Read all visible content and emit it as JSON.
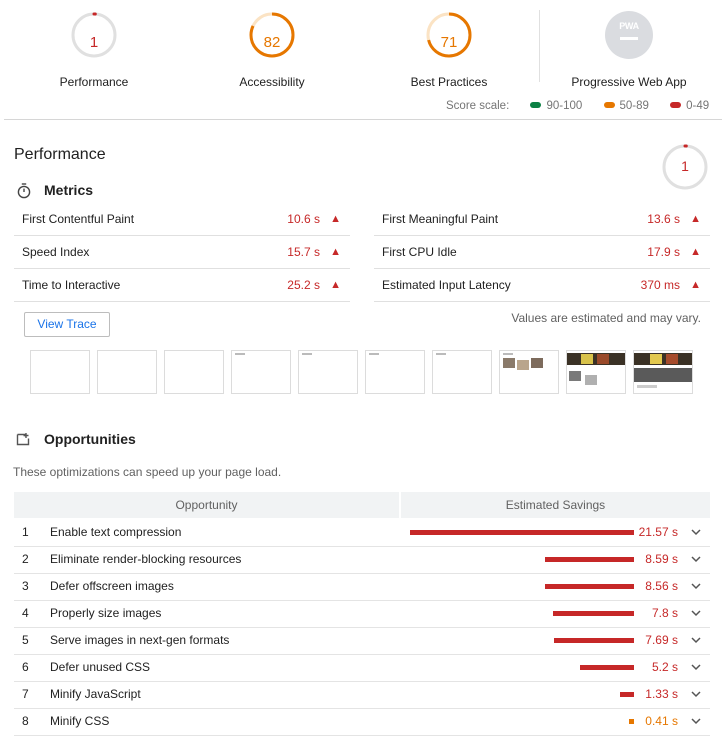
{
  "gauges": [
    {
      "score": "1",
      "label": "Performance",
      "color": "#c62828",
      "fraction": 0.01
    },
    {
      "score": "82",
      "label": "Accessibility",
      "color": "#e67700",
      "fraction": 0.82
    },
    {
      "score": "71",
      "label": "Best Practices",
      "color": "#e67700",
      "fraction": 0.71
    }
  ],
  "pwa": {
    "badge": "PWA",
    "label": "Progressive Web App"
  },
  "score_scale": {
    "label": "Score scale:",
    "items": [
      {
        "range": "90-100",
        "color": "#0b8043"
      },
      {
        "range": "50-89",
        "color": "#e67700"
      },
      {
        "range": "0-49",
        "color": "#c62828"
      }
    ]
  },
  "performance": {
    "title": "Performance",
    "score": "1",
    "metrics_title": "Metrics",
    "metrics": [
      {
        "label": "First Contentful Paint",
        "value": "10.6 s"
      },
      {
        "label": "First Meaningful Paint",
        "value": "13.6 s"
      },
      {
        "label": "Speed Index",
        "value": "15.7 s"
      },
      {
        "label": "First CPU Idle",
        "value": "17.9 s"
      },
      {
        "label": "Time to Interactive",
        "value": "25.2 s"
      },
      {
        "label": "Estimated Input Latency",
        "value": "370 ms"
      }
    ],
    "view_trace": "View Trace",
    "estimate_note": "Values are estimated and may vary."
  },
  "opportunities": {
    "title": "Opportunities",
    "description": "These optimizations can speed up your page load.",
    "col_opportunity": "Opportunity",
    "col_savings": "Estimated Savings",
    "rows": [
      {
        "num": "1",
        "name": "Enable text compression",
        "savings": "21.57 s",
        "seconds": 21.57,
        "color": "#c62828"
      },
      {
        "num": "2",
        "name": "Eliminate render-blocking resources",
        "savings": "8.59 s",
        "seconds": 8.59,
        "color": "#c62828"
      },
      {
        "num": "3",
        "name": "Defer offscreen images",
        "savings": "8.56 s",
        "seconds": 8.56,
        "color": "#c62828"
      },
      {
        "num": "4",
        "name": "Properly size images",
        "savings": "7.8 s",
        "seconds": 7.8,
        "color": "#c62828"
      },
      {
        "num": "5",
        "name": "Serve images in next-gen formats",
        "savings": "7.69 s",
        "seconds": 7.69,
        "color": "#c62828"
      },
      {
        "num": "6",
        "name": "Defer unused CSS",
        "savings": "5.2 s",
        "seconds": 5.2,
        "color": "#c62828"
      },
      {
        "num": "7",
        "name": "Minify JavaScript",
        "savings": "1.33 s",
        "seconds": 1.33,
        "color": "#c62828"
      },
      {
        "num": "8",
        "name": "Minify CSS",
        "savings": "0.41 s",
        "seconds": 0.41,
        "color": "#e67700"
      }
    ]
  }
}
